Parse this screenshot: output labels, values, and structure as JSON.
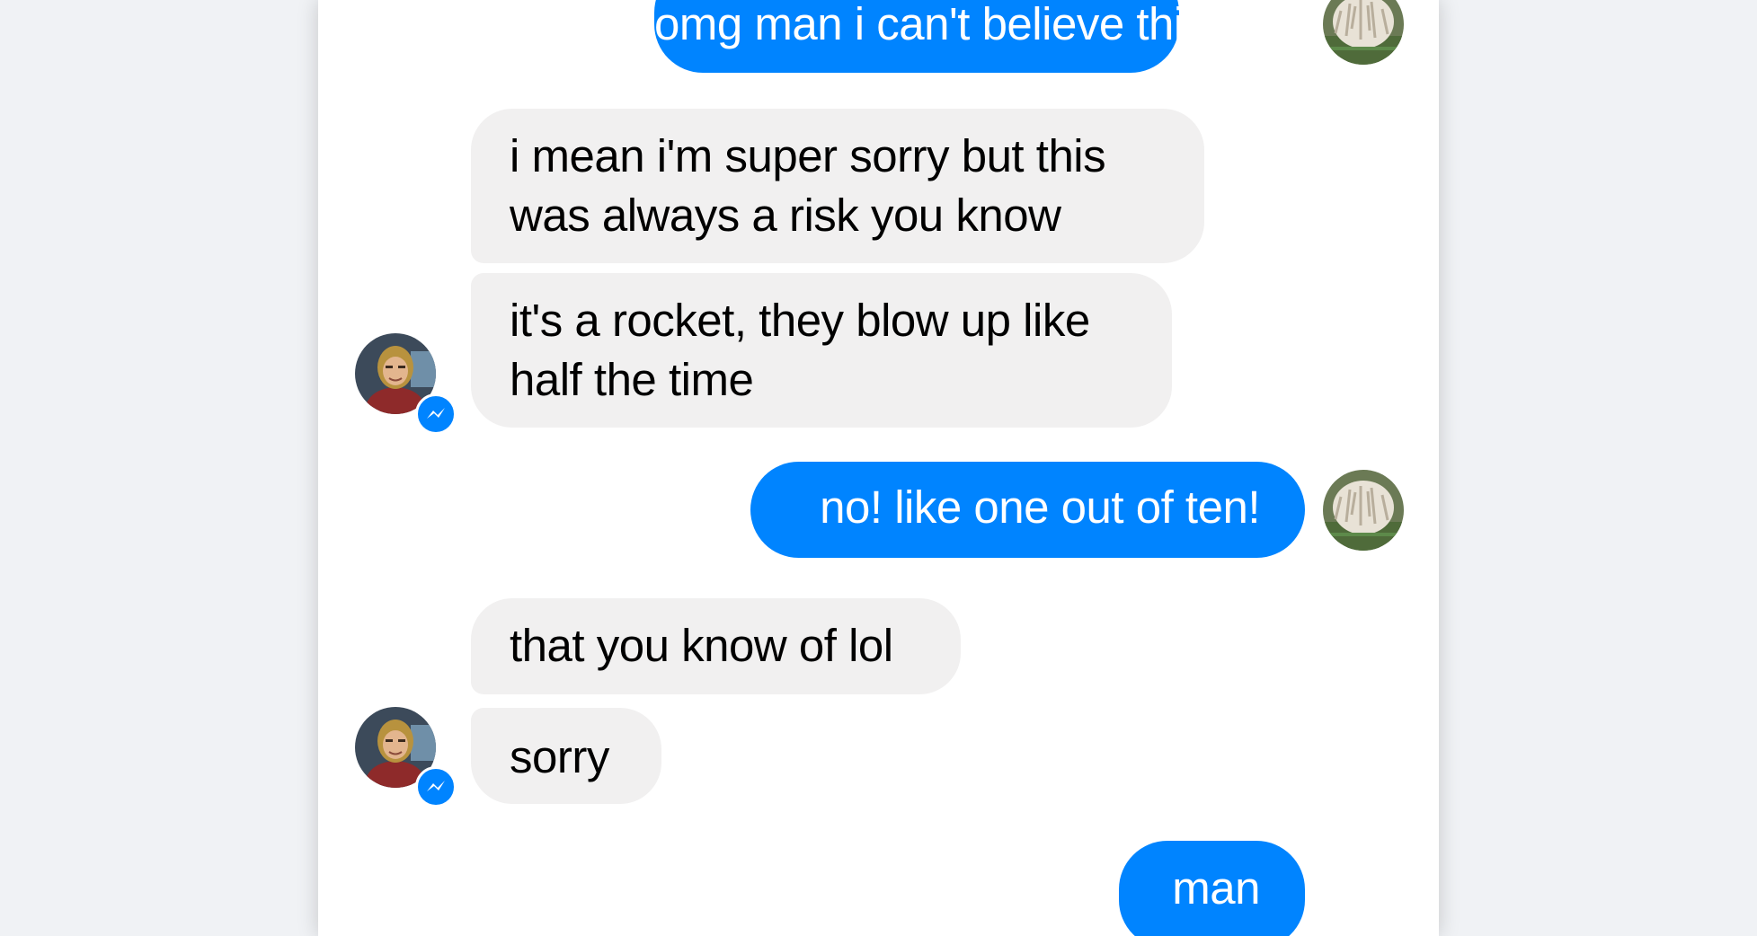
{
  "conversation": {
    "messages": [
      {
        "sender": "me",
        "text": "omg man i can't believe this"
      },
      {
        "sender": "them",
        "lines": [
          "i mean i'm super sorry but this",
          "was always a risk you know"
        ]
      },
      {
        "sender": "them",
        "lines": [
          "it's a rocket, they blow up like",
          "half the time"
        ]
      },
      {
        "sender": "me",
        "text": "no! like one out of ten!"
      },
      {
        "sender": "them",
        "text": "that you know of lol"
      },
      {
        "sender": "them",
        "text": "sorry"
      },
      {
        "sender": "me",
        "text": "man"
      }
    ]
  },
  "avatars": {
    "me": "dog-avatar-icon",
    "them": "person-avatar-icon",
    "badge": "messenger-badge-icon"
  },
  "colors": {
    "page_bg": "#f0f2f5",
    "panel_bg": "#ffffff",
    "outgoing_bubble": "#0084ff",
    "outgoing_text": "#ffffff",
    "incoming_bubble": "#f1f0f0",
    "incoming_text": "#000000",
    "badge": "#0084ff"
  }
}
